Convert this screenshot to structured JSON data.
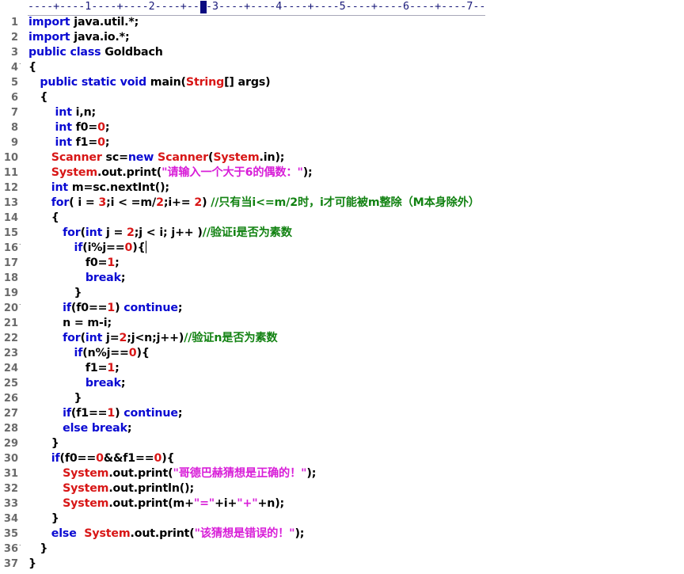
{
  "ruler": {
    "text": "----+----1----+----2----+----3----+----4----+----5----+----6----+----7--"
  },
  "gutter": {
    "line_numbers": [
      "1",
      "2",
      "3",
      "4",
      "5",
      "6",
      "7",
      "8",
      "9",
      "10",
      "11",
      "12",
      "13",
      "14",
      "15",
      "16",
      "17",
      "18",
      "19",
      "20",
      "21",
      "22",
      "23",
      "24",
      "25",
      "26",
      "27",
      "28",
      "29",
      "30",
      "31",
      "32",
      "33",
      "34",
      "35",
      "36",
      "37"
    ]
  },
  "colors": {
    "keyword": "#0a0ad2",
    "class": "#d81616",
    "number": "#d81616",
    "string": "#d81ed8",
    "comment": "#128212",
    "plain": "#000000",
    "line_number": "#6a6a6a",
    "ruler_cursor": "#0a0a80"
  },
  "code": {
    "lines": [
      [
        [
          "kw",
          "import"
        ],
        [
          "pl",
          " java.util.*;"
        ]
      ],
      [
        [
          "kw",
          "import"
        ],
        [
          "pl",
          " java.io.*;"
        ]
      ],
      [
        [
          "kw",
          "public"
        ],
        [
          "pl",
          " "
        ],
        [
          "kw",
          "class"
        ],
        [
          "pl",
          " Goldbach"
        ]
      ],
      [
        [
          "pl",
          "{"
        ]
      ],
      [
        [
          "pl",
          "   "
        ],
        [
          "kw",
          "public"
        ],
        [
          "pl",
          " "
        ],
        [
          "kw",
          "static"
        ],
        [
          "pl",
          " "
        ],
        [
          "kw",
          "void"
        ],
        [
          "pl",
          " main("
        ],
        [
          "cls",
          "String"
        ],
        [
          "pl",
          "[] args)"
        ]
      ],
      [
        [
          "pl",
          "   {"
        ]
      ],
      [
        [
          "pl",
          "       "
        ],
        [
          "kw",
          "int"
        ],
        [
          "pl",
          " i,n;"
        ]
      ],
      [
        [
          "pl",
          "       "
        ],
        [
          "kw",
          "int"
        ],
        [
          "pl",
          " f0="
        ],
        [
          "num",
          "0"
        ],
        [
          "pl",
          ";"
        ]
      ],
      [
        [
          "pl",
          "       "
        ],
        [
          "kw",
          "int"
        ],
        [
          "pl",
          " f1="
        ],
        [
          "num",
          "0"
        ],
        [
          "pl",
          ";"
        ]
      ],
      [
        [
          "pl",
          "      "
        ],
        [
          "cls",
          "Scanner"
        ],
        [
          "pl",
          " sc="
        ],
        [
          "kw",
          "new"
        ],
        [
          "pl",
          " "
        ],
        [
          "cls",
          "Scanner"
        ],
        [
          "pl",
          "("
        ],
        [
          "cls",
          "System"
        ],
        [
          "pl",
          ".in);"
        ]
      ],
      [
        [
          "pl",
          "      "
        ],
        [
          "cls",
          "System"
        ],
        [
          "pl",
          ".out.print("
        ],
        [
          "str",
          "\"请输入一个大于6的偶数：\""
        ],
        [
          "pl",
          ");"
        ]
      ],
      [
        [
          "pl",
          "      "
        ],
        [
          "kw",
          "int"
        ],
        [
          "pl",
          " m=sc.nextInt();"
        ]
      ],
      [
        [
          "pl",
          "      "
        ],
        [
          "kw",
          "for"
        ],
        [
          "pl",
          "( i = "
        ],
        [
          "num",
          "3"
        ],
        [
          "pl",
          ";i < =m/"
        ],
        [
          "num",
          "2"
        ],
        [
          "pl",
          ";i+= "
        ],
        [
          "num",
          "2"
        ],
        [
          "pl",
          ") "
        ],
        [
          "cmt",
          "//只有当i<=m/2时，i才可能被m整除（M本身除外）"
        ]
      ],
      [
        [
          "pl",
          "      {"
        ]
      ],
      [
        [
          "pl",
          "         "
        ],
        [
          "kw",
          "for"
        ],
        [
          "pl",
          "("
        ],
        [
          "kw",
          "int"
        ],
        [
          "pl",
          " j = "
        ],
        [
          "num",
          "2"
        ],
        [
          "pl",
          ";j < i; j++ )"
        ],
        [
          "cmt",
          "//验证i是否为素数"
        ]
      ],
      [
        [
          "pl",
          "            "
        ],
        [
          "kw",
          "if"
        ],
        [
          "pl",
          "(i%j=="
        ],
        [
          "num",
          "0"
        ],
        [
          "pl",
          "){"
        ],
        [
          "caret",
          ""
        ]
      ],
      [
        [
          "pl",
          "               f0="
        ],
        [
          "num",
          "1"
        ],
        [
          "pl",
          ";"
        ]
      ],
      [
        [
          "pl",
          "               "
        ],
        [
          "kw",
          "break"
        ],
        [
          "pl",
          ";"
        ]
      ],
      [
        [
          "pl",
          "            }"
        ]
      ],
      [
        [
          "pl",
          "         "
        ],
        [
          "kw",
          "if"
        ],
        [
          "pl",
          "(f0=="
        ],
        [
          "num",
          "1"
        ],
        [
          "pl",
          ") "
        ],
        [
          "kw",
          "continue"
        ],
        [
          "pl",
          ";"
        ]
      ],
      [
        [
          "pl",
          "         n = m-i;"
        ]
      ],
      [
        [
          "pl",
          "         "
        ],
        [
          "kw",
          "for"
        ],
        [
          "pl",
          "("
        ],
        [
          "kw",
          "int"
        ],
        [
          "pl",
          " j="
        ],
        [
          "num",
          "2"
        ],
        [
          "pl",
          ";j<n;j++)"
        ],
        [
          "cmt",
          "//验证n是否为素数"
        ]
      ],
      [
        [
          "pl",
          "            "
        ],
        [
          "kw",
          "if"
        ],
        [
          "pl",
          "(n%j=="
        ],
        [
          "num",
          "0"
        ],
        [
          "pl",
          "){"
        ]
      ],
      [
        [
          "pl",
          "               f1="
        ],
        [
          "num",
          "1"
        ],
        [
          "pl",
          ";"
        ]
      ],
      [
        [
          "pl",
          "               "
        ],
        [
          "kw",
          "break"
        ],
        [
          "pl",
          ";"
        ]
      ],
      [
        [
          "pl",
          "            }"
        ]
      ],
      [
        [
          "pl",
          "         "
        ],
        [
          "kw",
          "if"
        ],
        [
          "pl",
          "(f1=="
        ],
        [
          "num",
          "1"
        ],
        [
          "pl",
          ") "
        ],
        [
          "kw",
          "continue"
        ],
        [
          "pl",
          ";"
        ]
      ],
      [
        [
          "pl",
          "         "
        ],
        [
          "kw",
          "else"
        ],
        [
          "pl",
          " "
        ],
        [
          "kw",
          "break"
        ],
        [
          "pl",
          ";"
        ]
      ],
      [
        [
          "pl",
          "      }"
        ]
      ],
      [
        [
          "pl",
          "      "
        ],
        [
          "kw",
          "if"
        ],
        [
          "pl",
          "(f0=="
        ],
        [
          "num",
          "0"
        ],
        [
          "pl",
          "&&f1=="
        ],
        [
          "num",
          "0"
        ],
        [
          "pl",
          "){"
        ]
      ],
      [
        [
          "pl",
          "         "
        ],
        [
          "cls",
          "System"
        ],
        [
          "pl",
          ".out.print("
        ],
        [
          "str",
          "\"哥德巴赫猜想是正确的！\""
        ],
        [
          "pl",
          ");"
        ]
      ],
      [
        [
          "pl",
          "         "
        ],
        [
          "cls",
          "System"
        ],
        [
          "pl",
          ".out.println();"
        ]
      ],
      [
        [
          "pl",
          "         "
        ],
        [
          "cls",
          "System"
        ],
        [
          "pl",
          ".out.print(m+"
        ],
        [
          "str",
          "\"=\""
        ],
        [
          "pl",
          "+i+"
        ],
        [
          "str",
          "\"+\""
        ],
        [
          "pl",
          "+n);"
        ]
      ],
      [
        [
          "pl",
          "      }"
        ]
      ],
      [
        [
          "pl",
          "      "
        ],
        [
          "kw",
          "else"
        ],
        [
          "pl",
          "  "
        ],
        [
          "cls",
          "System"
        ],
        [
          "pl",
          ".out.print("
        ],
        [
          "str",
          "\"该猜想是错误的！\""
        ],
        [
          "pl",
          ");"
        ]
      ],
      [
        [
          "pl",
          "   }"
        ]
      ],
      [
        [
          "pl",
          "}"
        ]
      ]
    ]
  }
}
